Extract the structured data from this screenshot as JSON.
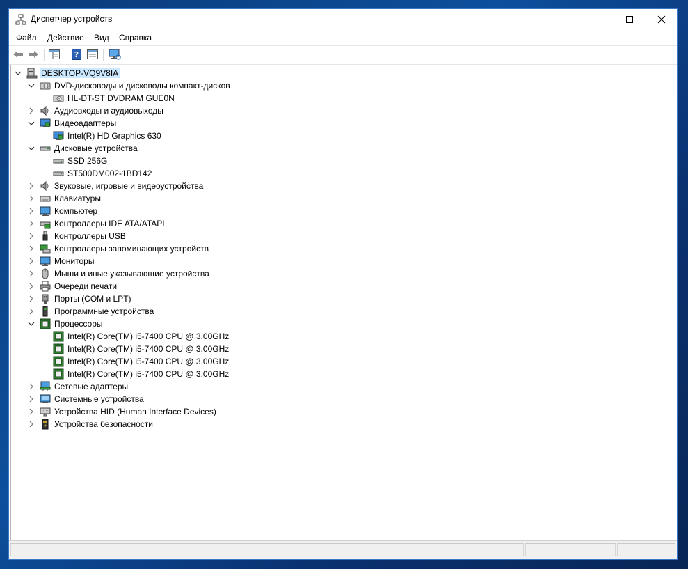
{
  "window": {
    "title": "Диспетчер устройств"
  },
  "menu": [
    {
      "label": "Файл"
    },
    {
      "label": "Действие"
    },
    {
      "label": "Вид"
    },
    {
      "label": "Справка"
    }
  ],
  "tree": {
    "root": "DESKTOP-VQ9V8IA",
    "categories": [
      {
        "label": "DVD-дисководы и дисководы компакт-дисков",
        "icon": "dvd-drive-icon",
        "expanded": true,
        "children": [
          {
            "label": "HL-DT-ST DVDRAM GUE0N",
            "icon": "dvd-drive-icon"
          }
        ]
      },
      {
        "label": "Аудиовходы и аудиовыходы",
        "icon": "speaker-icon",
        "expanded": false
      },
      {
        "label": "Видеоадаптеры",
        "icon": "display-adapter-icon",
        "expanded": true,
        "children": [
          {
            "label": "Intel(R) HD Graphics 630",
            "icon": "display-adapter-icon"
          }
        ]
      },
      {
        "label": "Дисковые устройства",
        "icon": "disk-drive-icon",
        "expanded": true,
        "children": [
          {
            "label": "SSD 256G",
            "icon": "disk-drive-icon"
          },
          {
            "label": "ST500DM002-1BD142",
            "icon": "disk-drive-icon"
          }
        ]
      },
      {
        "label": "Звуковые, игровые и видеоустройства",
        "icon": "speaker-icon",
        "expanded": false
      },
      {
        "label": "Клавиатуры",
        "icon": "keyboard-icon",
        "expanded": false
      },
      {
        "label": "Компьютер",
        "icon": "computer-icon",
        "expanded": false
      },
      {
        "label": "Контроллеры IDE ATA/ATAPI",
        "icon": "ide-controller-icon",
        "expanded": false
      },
      {
        "label": "Контроллеры USB",
        "icon": "usb-icon",
        "expanded": false
      },
      {
        "label": "Контроллеры запоминающих устройств",
        "icon": "storage-controller-icon",
        "expanded": false
      },
      {
        "label": "Мониторы",
        "icon": "monitor-icon",
        "expanded": false
      },
      {
        "label": "Мыши и иные указывающие устройства",
        "icon": "mouse-icon",
        "expanded": false
      },
      {
        "label": "Очереди печати",
        "icon": "printer-icon",
        "expanded": false
      },
      {
        "label": "Порты (COM и LPT)",
        "icon": "port-icon",
        "expanded": false
      },
      {
        "label": "Программные устройства",
        "icon": "software-device-icon",
        "expanded": false
      },
      {
        "label": "Процессоры",
        "icon": "processor-icon",
        "expanded": true,
        "children": [
          {
            "label": "Intel(R) Core(TM) i5-7400 CPU @ 3.00GHz",
            "icon": "processor-icon"
          },
          {
            "label": "Intel(R) Core(TM) i5-7400 CPU @ 3.00GHz",
            "icon": "processor-icon"
          },
          {
            "label": "Intel(R) Core(TM) i5-7400 CPU @ 3.00GHz",
            "icon": "processor-icon"
          },
          {
            "label": "Intel(R) Core(TM) i5-7400 CPU @ 3.00GHz",
            "icon": "processor-icon"
          }
        ]
      },
      {
        "label": "Сетевые адаптеры",
        "icon": "network-adapter-icon",
        "expanded": false
      },
      {
        "label": "Системные устройства",
        "icon": "system-device-icon",
        "expanded": false
      },
      {
        "label": "Устройства HID (Human Interface Devices)",
        "icon": "hid-icon",
        "expanded": false
      },
      {
        "label": "Устройства безопасности",
        "icon": "security-device-icon",
        "expanded": false
      }
    ]
  }
}
